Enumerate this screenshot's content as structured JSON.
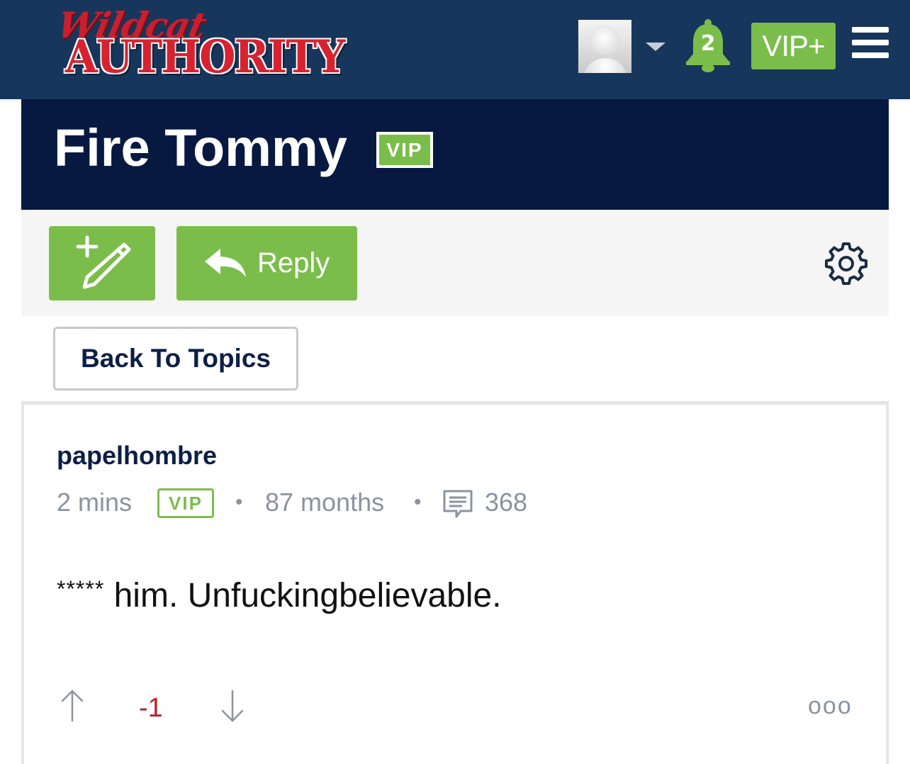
{
  "header": {
    "logo_script": "Wildcat",
    "logo_main": "AUTHORITY",
    "notification_count": "2",
    "vip_plus_label": "VIP+"
  },
  "topic": {
    "title": "Fire Tommy",
    "vip_badge": "VIP"
  },
  "toolbar": {
    "reply_label": "Reply",
    "back_label": "Back To Topics"
  },
  "post": {
    "username": "papelhombre",
    "time": "2 mins",
    "vip_badge": "VIP",
    "tenure": "87 months",
    "post_count": "368",
    "body_stars": "*****",
    "body_text": " him. Unfuckingbelievable.",
    "score": "-1",
    "more_label": "ooo"
  },
  "colors": {
    "header_bg": "#17365c",
    "title_bg": "#071941",
    "accent_green": "#7bbd4b",
    "score_red": "#b8232f",
    "muted_text": "#8a939e"
  },
  "icons": [
    "avatar",
    "caret-down-icon",
    "bell-icon",
    "hamburger-menu-icon",
    "new-topic-pencil-icon",
    "reply-arrow-icon",
    "gear-icon",
    "comment-icon",
    "arrow-up-icon",
    "arrow-down-icon",
    "more-options-icon"
  ]
}
